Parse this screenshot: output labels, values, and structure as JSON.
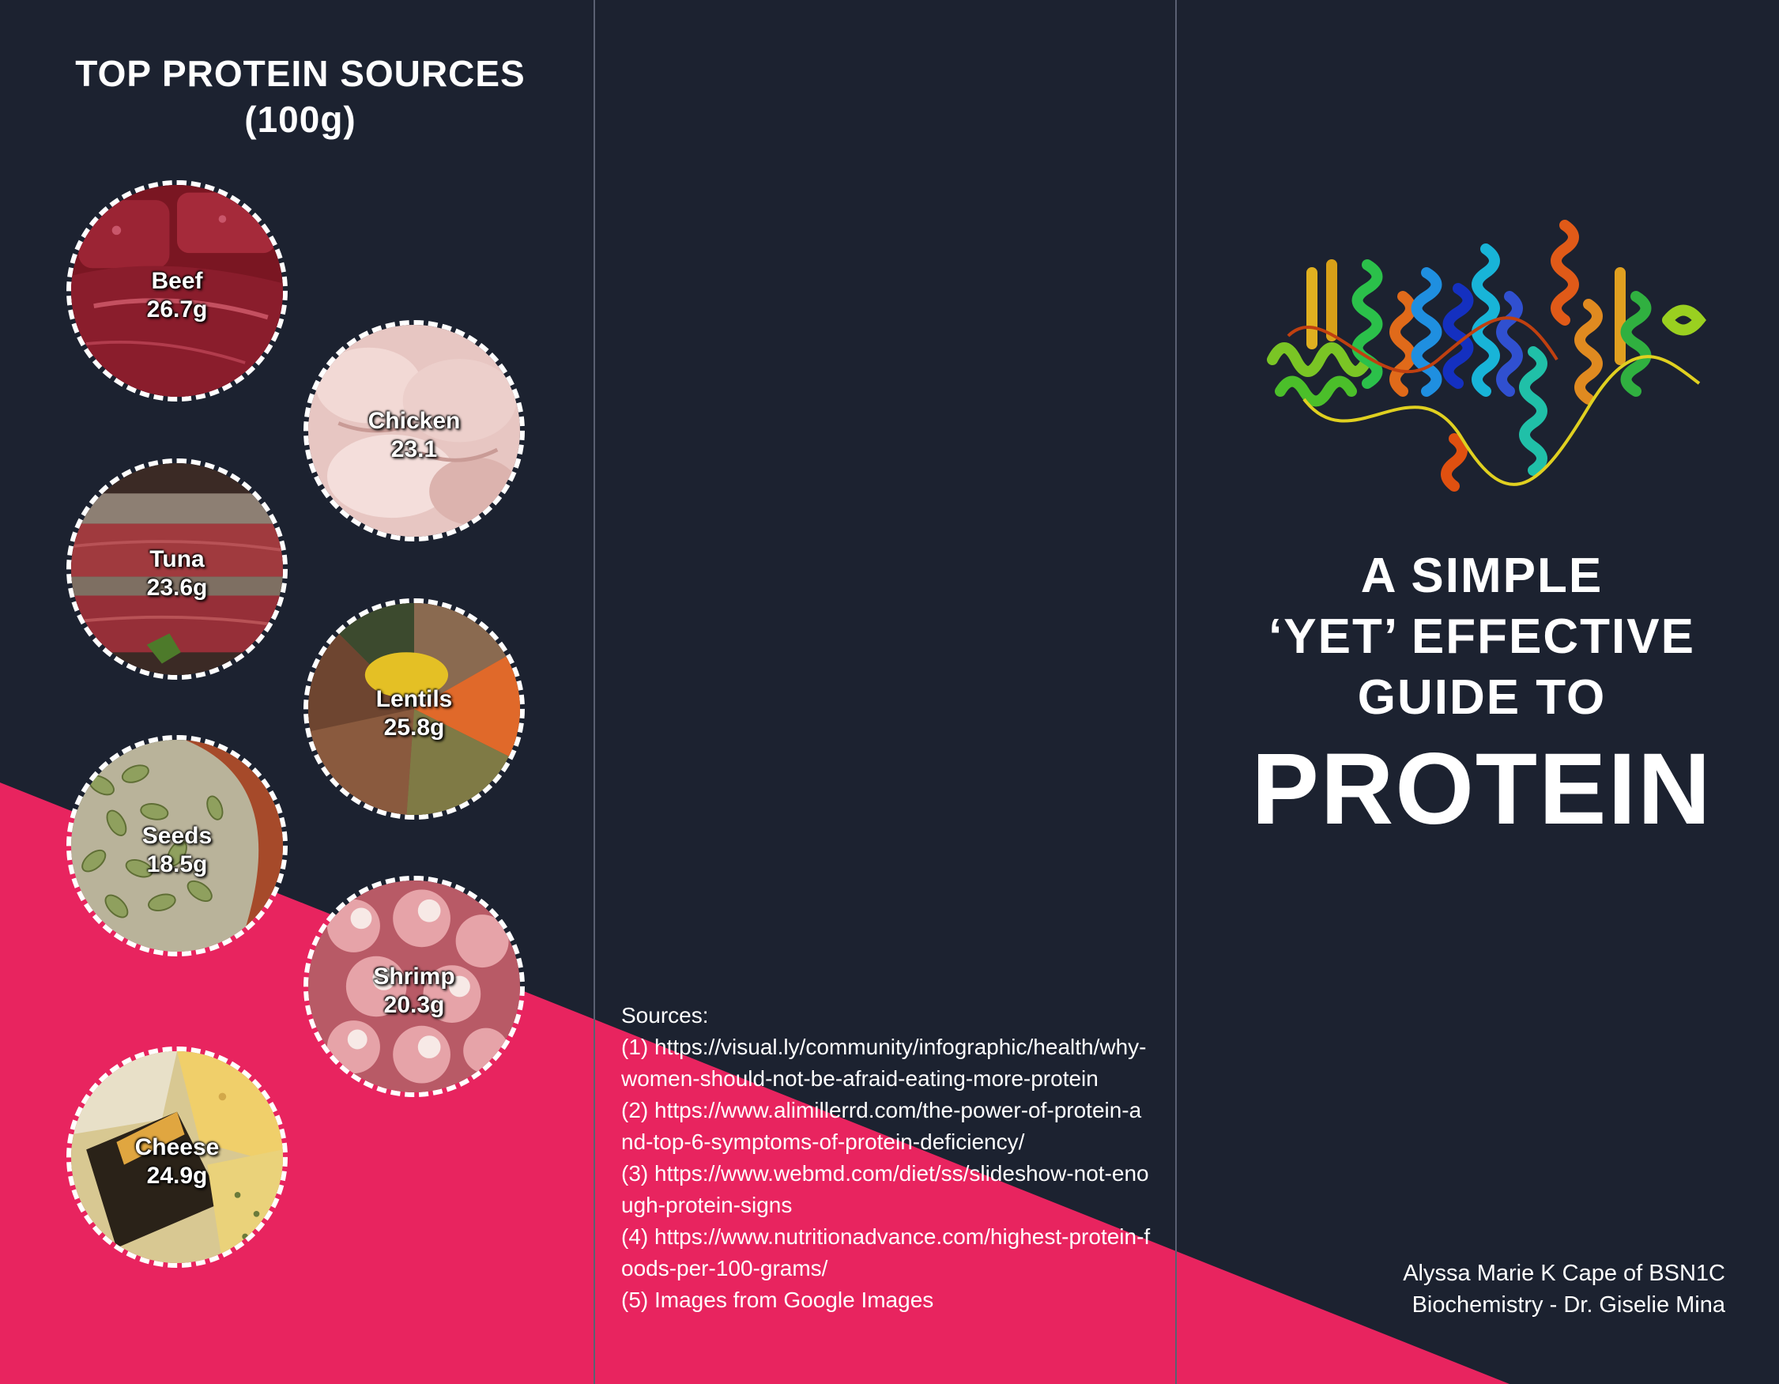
{
  "colors": {
    "background": "#1c2230",
    "accent": "#e8245f",
    "text": "#ffffff"
  },
  "left_panel": {
    "title_line1": "TOP PROTEIN SOURCES",
    "title_line2": "(100g)",
    "foods": [
      {
        "name": "Beef",
        "amount": "26.7g"
      },
      {
        "name": "Chicken",
        "amount": "23.1"
      },
      {
        "name": "Tuna",
        "amount": "23.6g"
      },
      {
        "name": "Lentils",
        "amount": "25.8g"
      },
      {
        "name": "Seeds",
        "amount": "18.5g"
      },
      {
        "name": "Shrimp",
        "amount": "20.3g"
      },
      {
        "name": "Cheese",
        "amount": "24.9g"
      }
    ]
  },
  "middle_panel": {
    "sources_heading": "Sources:",
    "source_lines": [
      "(1) https://visual.ly/community/infographic/health/why-",
      "women-should-not-be-afraid-eating-more-protein",
      "(2) https://www.alimillerrd.com/the-power-of-protein-a",
      "nd-top-6-symptoms-of-protein-deficiency/",
      "(3) https://www.webmd.com/diet/ss/slideshow-not-eno",
      "ugh-protein-signs",
      "(4) https://www.nutritionadvance.com/highest-protein-f",
      "oods-per-100-grams/",
      "(5) Images from Google Images"
    ]
  },
  "cover": {
    "title_line1": "A SIMPLE",
    "title_line2": "‘YET’ EFFECTIVE",
    "title_line3": "GUIDE TO",
    "title_main": "PROTEIN",
    "author": "Alyssa Marie K Cape of BSN1C",
    "course": "Biochemistry - Dr. Giselie Mina"
  }
}
